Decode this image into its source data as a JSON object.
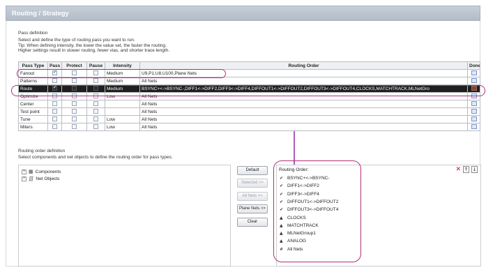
{
  "window": {
    "title": "Routing / Strategy"
  },
  "pass_definition": {
    "heading": "Pass definition",
    "description_lines": [
      "Select and define the type of routing pass you want to run.",
      "Tip: When defining intensity, the lower the value set, the faster the routing.",
      "Higher settings result in slower routing, fewer vias, and shorter trace length."
    ],
    "columns": [
      "Pass Type",
      "Pass",
      "Protect",
      "Pause",
      "Intensity",
      "Routing Order",
      "Done"
    ],
    "rows": [
      {
        "type": "Fanout",
        "pass": true,
        "protect": false,
        "pause": false,
        "intensity": "Medium",
        "order": "U9,P1,U8,U100,Plane Nets",
        "selected": false
      },
      {
        "type": "Patterns",
        "pass": false,
        "protect": false,
        "pause": false,
        "intensity": "Medium",
        "order": "All Nets",
        "selected": false
      },
      {
        "type": "Route",
        "pass": true,
        "protect": false,
        "pause": false,
        "intensity": "Medium",
        "order": "BSYNC+<->BSYNC-,DIFF1<->DIFF2,DIFF3<->DIFF4,DIFFOUT1<->DIFFOUT2,DIFFOUT3<->DIFFOUT4,CLOCKS,MATCHTRACK,MLNetGro",
        "selected": true
      },
      {
        "type": "Optimize",
        "pass": false,
        "protect": false,
        "pause": false,
        "intensity": "Low",
        "order": "All Nets",
        "selected": false
      },
      {
        "type": "Center",
        "pass": false,
        "protect": false,
        "pause": false,
        "intensity": "",
        "order": "All Nets",
        "selected": false
      },
      {
        "type": "Test point",
        "pass": false,
        "protect": false,
        "pause": false,
        "intensity": "",
        "order": "All Nets",
        "selected": false
      },
      {
        "type": "Tune",
        "pass": false,
        "protect": false,
        "pause": false,
        "intensity": "Low",
        "order": "All Nets",
        "selected": false
      },
      {
        "type": "Miters",
        "pass": false,
        "protect": false,
        "pause": false,
        "intensity": "Low",
        "order": "All Nets",
        "selected": false
      }
    ]
  },
  "routing_order_definition": {
    "heading": "Routing order definition",
    "description": "Select components and net objects to define the routing order for pass types.",
    "tree": [
      {
        "label": "Components",
        "icon": "components-icon"
      },
      {
        "label": "Net Objects",
        "icon": "net-objects-icon"
      }
    ],
    "buttons": {
      "default": "Default",
      "selected": "Selected >>",
      "all_nets": "All Nets >>",
      "plane_nets": "Plane Nets >>",
      "clear": "Clear"
    },
    "order_list": {
      "header": "Routing Order:",
      "items": [
        "BSYNC+<->BSYNC-",
        "DIFF1<->DIFF2",
        "DIFF3<->DIFF4",
        "DIFFOUT1<->DIFFOUT2",
        "DIFFOUT3<->DIFFOUT4",
        "CLOCKS",
        "MATCHTRACK",
        "MLNetGroup1",
        "ANALOG",
        "All Nets"
      ]
    }
  },
  "colors": {
    "annotation": "#b0307a",
    "arrow": "#b058c0",
    "title_bg": "#b3bcc9"
  }
}
